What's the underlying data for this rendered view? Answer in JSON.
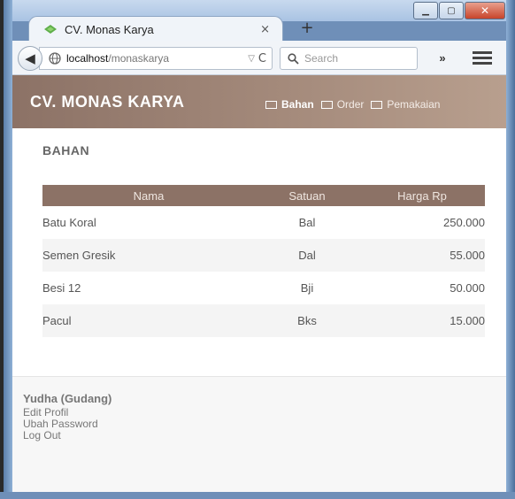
{
  "window": {
    "minimize_glyph": "▁",
    "maximize_glyph": "▢",
    "close_glyph": "✕"
  },
  "browser": {
    "tab_title": "CV. Monas Karya",
    "tab_close": "×",
    "new_tab": "+",
    "back_glyph": "◀",
    "url_host": "localhost",
    "url_path": "/monaskarya",
    "url_dropdown": "▽",
    "url_reload": "C",
    "search_placeholder": "Search",
    "overflow_label": "»"
  },
  "site": {
    "brand": "CV. MONAS KARYA",
    "nav": [
      {
        "label": "Bahan"
      },
      {
        "label": "Order"
      },
      {
        "label": "Pemakaian"
      }
    ],
    "active_nav": "Bahan"
  },
  "main": {
    "title": "BAHAN",
    "columns": [
      "Nama",
      "Satuan",
      "Harga Rp"
    ],
    "rows": [
      {
        "nama": "Batu Koral",
        "satuan": "Bal",
        "harga": "250.000"
      },
      {
        "nama": "Semen Gresik",
        "satuan": "Dal",
        "harga": "55.000"
      },
      {
        "nama": "Besi 12",
        "satuan": "Bji",
        "harga": "50.000"
      },
      {
        "nama": "Pacul",
        "satuan": "Bks",
        "harga": "15.000"
      }
    ]
  },
  "footer": {
    "user": "Yudha (Gudang)",
    "links": [
      "Edit Profil",
      "Ubah Password",
      "Log Out"
    ]
  },
  "colors": {
    "header_brown": "#8c7266",
    "frame_blue": "#6f8fb8"
  }
}
